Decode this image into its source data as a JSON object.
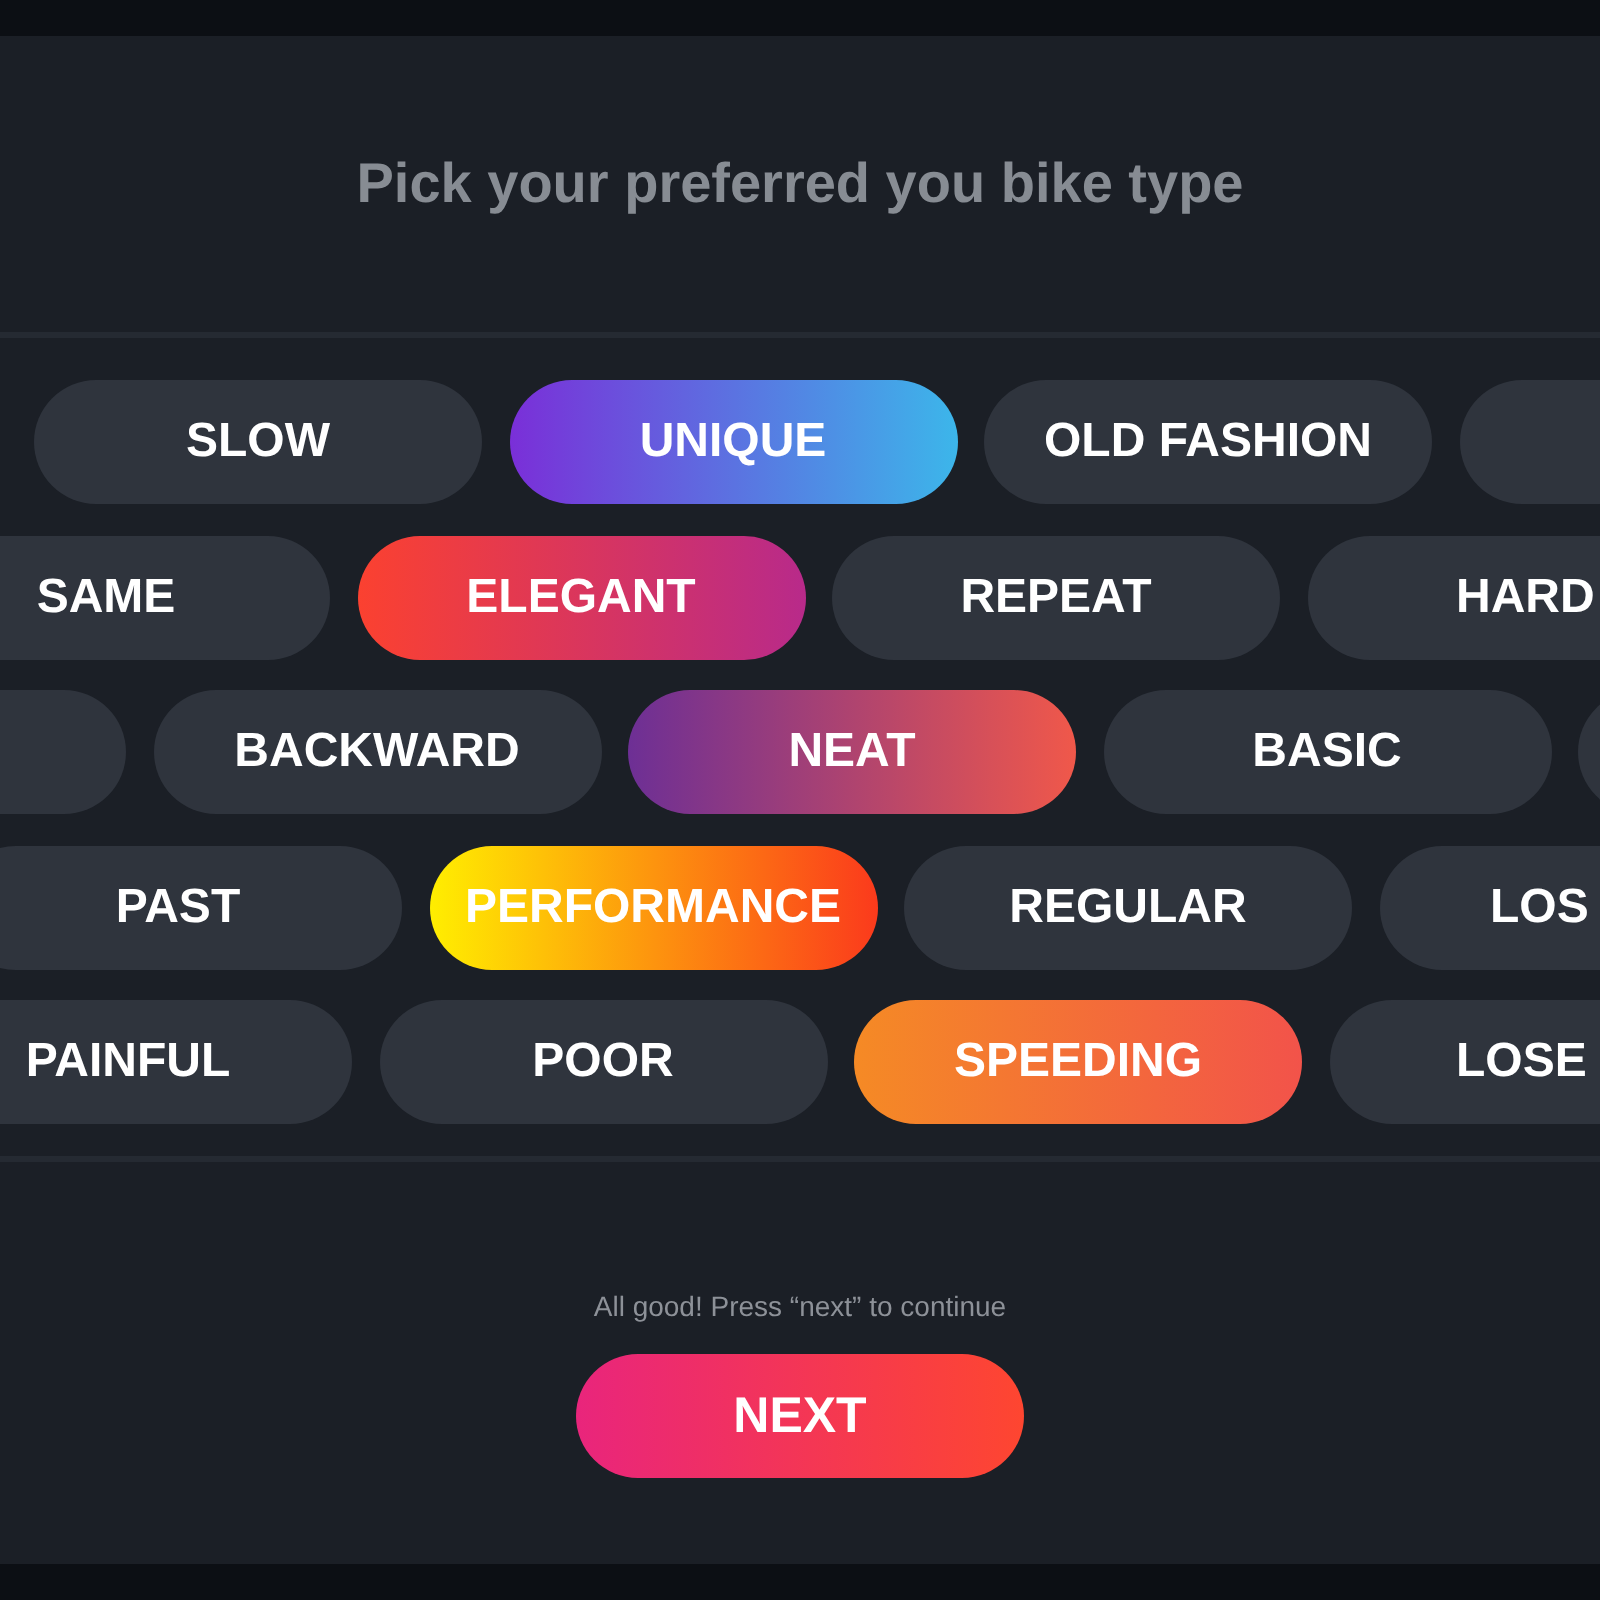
{
  "title": "Pick your preferred you bike type",
  "rows": [
    {
      "chips": [
        {
          "label": "SLOW",
          "selected": false
        },
        {
          "label": "UNIQUE",
          "selected": true,
          "gradient": [
            {
              "color": "#7a2fd8"
            },
            {
              "color": "#3cb6ea"
            }
          ]
        },
        {
          "label": "OLD FASHION",
          "selected": false
        },
        {
          "selected": false
        }
      ]
    },
    {
      "chips": [
        {
          "label": "SAME",
          "selected": false
        },
        {
          "label": "ELEGANT",
          "selected": true,
          "gradient": [
            {
              "color": "#fb4130"
            },
            {
              "color": "#b82a8a"
            }
          ]
        },
        {
          "label": "REPEAT",
          "selected": false
        },
        {
          "label": "HARD",
          "selected": false
        }
      ]
    },
    {
      "chips": [
        {
          "selected": false
        },
        {
          "label": "BACKWARD",
          "selected": false
        },
        {
          "label": "NEAT",
          "selected": true,
          "gradient": [
            {
              "color": "#6d2f95"
            },
            {
              "color": "#f0584a"
            }
          ]
        },
        {
          "label": "BASIC",
          "selected": false
        },
        {
          "selected": false
        }
      ]
    },
    {
      "chips": [
        {
          "label": "PAST",
          "selected": false
        },
        {
          "label": "PERFORMANCE",
          "selected": true,
          "gradient": [
            {
              "color": "#ffee00"
            },
            {
              "color": "#fb3a1c"
            }
          ]
        },
        {
          "label": "REGULAR",
          "selected": false
        },
        {
          "label": "LOS",
          "selected": false
        }
      ]
    },
    {
      "chips": [
        {
          "label": "PAINFUL",
          "selected": false
        },
        {
          "label": "POOR",
          "selected": false
        },
        {
          "label": "SPEEDING",
          "selected": true,
          "gradient": [
            {
              "color": "#f58a25"
            },
            {
              "color": "#f2534a"
            }
          ]
        },
        {
          "label": "LOSE",
          "selected": false
        }
      ]
    }
  ],
  "hint": "All good! Press “next” to continue",
  "button": "NEXT"
}
